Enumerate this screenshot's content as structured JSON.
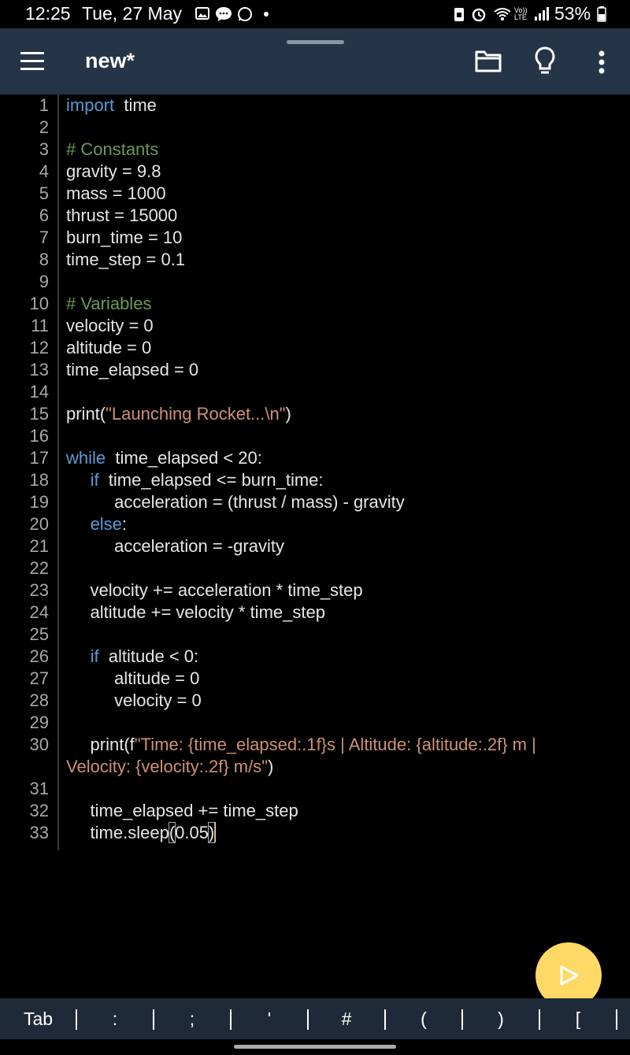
{
  "status": {
    "time": "12:25",
    "date": "Tue, 27 May",
    "battery": "53%"
  },
  "appbar": {
    "title": "new*"
  },
  "editor": {
    "lines": [
      {
        "n": "1",
        "segs": [
          {
            "t": "import",
            "c": "kw"
          },
          {
            "t": " time",
            "c": ""
          }
        ]
      },
      {
        "n": "2",
        "segs": []
      },
      {
        "n": "3",
        "segs": [
          {
            "t": "# Constants",
            "c": "cm"
          }
        ]
      },
      {
        "n": "4",
        "segs": [
          {
            "t": "gravity = 9.8",
            "c": ""
          }
        ]
      },
      {
        "n": "5",
        "segs": [
          {
            "t": "mass = 1000",
            "c": ""
          }
        ]
      },
      {
        "n": "6",
        "segs": [
          {
            "t": "thrust = 15000",
            "c": ""
          }
        ]
      },
      {
        "n": "7",
        "segs": [
          {
            "t": "burn_time = 10",
            "c": ""
          }
        ]
      },
      {
        "n": "8",
        "segs": [
          {
            "t": "time_step = 0.1",
            "c": ""
          }
        ]
      },
      {
        "n": "9",
        "segs": []
      },
      {
        "n": "10",
        "segs": [
          {
            "t": "# Variables",
            "c": "cm"
          }
        ]
      },
      {
        "n": "11",
        "segs": [
          {
            "t": "velocity = 0",
            "c": ""
          }
        ]
      },
      {
        "n": "12",
        "segs": [
          {
            "t": "altitude = 0",
            "c": ""
          }
        ]
      },
      {
        "n": "13",
        "segs": [
          {
            "t": "time_elapsed = 0",
            "c": ""
          }
        ]
      },
      {
        "n": "14",
        "segs": []
      },
      {
        "n": "15",
        "segs": [
          {
            "t": "print(",
            "c": ""
          },
          {
            "t": "\"Launching Rocket...\\n\"",
            "c": "st"
          },
          {
            "t": ")",
            "c": ""
          }
        ]
      },
      {
        "n": "16",
        "segs": []
      },
      {
        "n": "17",
        "segs": [
          {
            "t": "while",
            "c": "kw"
          },
          {
            "t": " time_elapsed < 20:",
            "c": ""
          }
        ]
      },
      {
        "n": "18",
        "segs": [
          {
            "t": "  ",
            "c": ""
          },
          {
            "t": "if",
            "c": "kw"
          },
          {
            "t": " time_elapsed <= burn_time:",
            "c": ""
          }
        ]
      },
      {
        "n": "19",
        "segs": [
          {
            "t": "    acceleration = (thrust / mass) - gravity",
            "c": ""
          }
        ]
      },
      {
        "n": "20",
        "segs": [
          {
            "t": "  ",
            "c": ""
          },
          {
            "t": "else",
            "c": "kw"
          },
          {
            "t": ":",
            "c": ""
          }
        ]
      },
      {
        "n": "21",
        "segs": [
          {
            "t": "    acceleration = -gravity",
            "c": ""
          }
        ]
      },
      {
        "n": "22",
        "segs": []
      },
      {
        "n": "23",
        "segs": [
          {
            "t": "  velocity += acceleration * time_step",
            "c": ""
          }
        ]
      },
      {
        "n": "24",
        "segs": [
          {
            "t": "  altitude += velocity * time_step",
            "c": ""
          }
        ]
      },
      {
        "n": "25",
        "segs": []
      },
      {
        "n": "26",
        "segs": [
          {
            "t": "  ",
            "c": ""
          },
          {
            "t": "if",
            "c": "kw"
          },
          {
            "t": " altitude < 0:",
            "c": ""
          }
        ]
      },
      {
        "n": "27",
        "segs": [
          {
            "t": "    altitude = 0",
            "c": ""
          }
        ]
      },
      {
        "n": "28",
        "segs": [
          {
            "t": "    velocity = 0",
            "c": ""
          }
        ]
      },
      {
        "n": "29",
        "segs": []
      },
      {
        "n": "30",
        "wrap": true,
        "segs": [
          {
            "t": "  print(f",
            "c": ""
          },
          {
            "t": "\"Time: {time_elapsed:.1f}s | Altitude: {altitude:.2f} m |",
            "c": "st"
          }
        ],
        "segs2": [
          {
            "t": "Velocity: {velocity:.2f} m/s\"",
            "c": "st"
          },
          {
            "t": ")",
            "c": ""
          }
        ]
      },
      {
        "n": "31",
        "segs": []
      },
      {
        "n": "32",
        "segs": [
          {
            "t": "  time_elapsed += time_step",
            "c": ""
          }
        ]
      },
      {
        "n": "33",
        "segs": [
          {
            "t": "  time.sleep",
            "c": ""
          },
          {
            "t": "(",
            "c": "bracket"
          },
          {
            "t": "0.05",
            "c": ""
          },
          {
            "t": ")",
            "c": "bracket"
          },
          {
            "t": "",
            "c": "cursor"
          }
        ]
      }
    ]
  },
  "symbols": [
    {
      "label": "Tab",
      "name": "symbol-tab"
    },
    {
      "label": ":",
      "name": "symbol-colon"
    },
    {
      "label": ";",
      "name": "symbol-semicolon"
    },
    {
      "label": "'",
      "name": "symbol-quote"
    },
    {
      "label": "#",
      "name": "symbol-hash"
    },
    {
      "label": "(",
      "name": "symbol-open-paren"
    },
    {
      "label": ")",
      "name": "symbol-close-paren"
    },
    {
      "label": "[",
      "name": "symbol-open-bracket"
    }
  ],
  "icons": {
    "menu": "hamburger-menu-icon",
    "folder": "folder-icon",
    "bulb": "lightbulb-icon",
    "more": "more-vertical-icon",
    "run": "play-icon"
  },
  "colors": {
    "appbar": "#253447",
    "keyword": "#569cd6",
    "comment": "#6a9955",
    "string": "#ce9178",
    "fab": "#ffd966"
  }
}
